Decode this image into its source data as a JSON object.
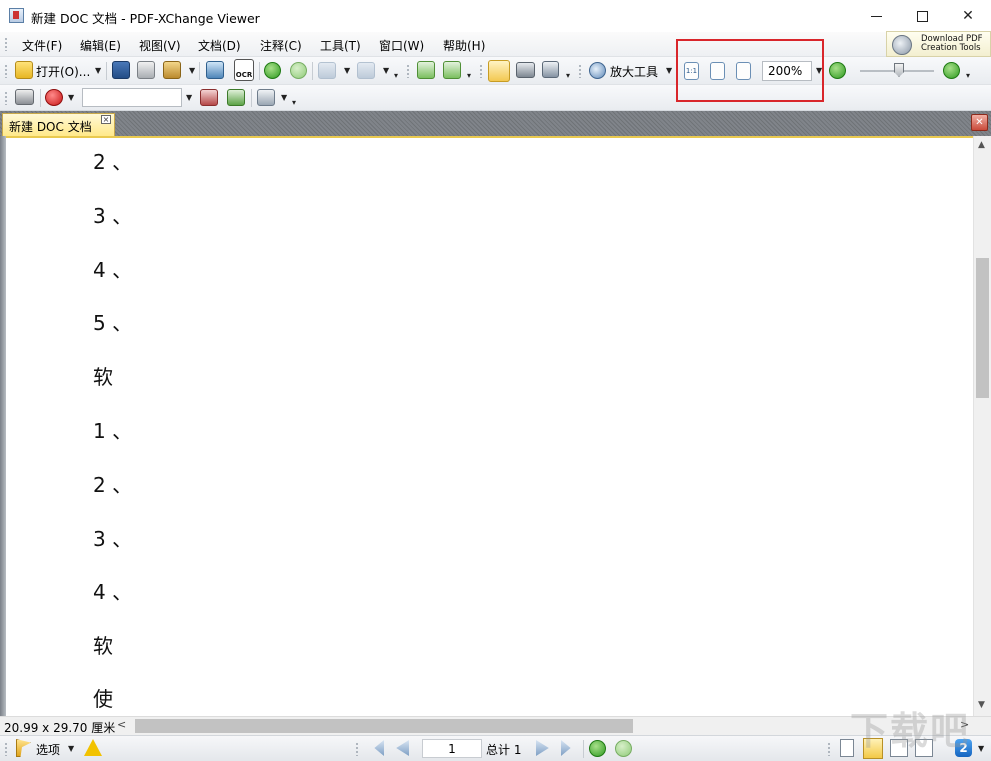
{
  "window": {
    "title": "新建 DOC 文档 - PDF-XChange Viewer"
  },
  "menu": [
    "文件(F)",
    "编辑(E)",
    "视图(V)",
    "文档(D)",
    "注释(C)",
    "工具(T)",
    "窗口(W)",
    "帮助(H)"
  ],
  "download": {
    "line1": "Download PDF",
    "line2": "Creation Tools"
  },
  "toolbar": {
    "open_label": "打开(O)...",
    "ocr_label": "OCR",
    "zoom_tool_label": "放大工具",
    "actual_size_label": "1:1",
    "zoom_value": "200%"
  },
  "tab": {
    "label": "新建 DOC 文档",
    "close": "×"
  },
  "document": {
    "lines": [
      "2 、",
      "3 、",
      "4 、",
      "5 、",
      "软",
      "1 、",
      "2 、",
      "3 、",
      "4 、",
      "软",
      "使"
    ]
  },
  "status": {
    "page_size": "20.99 x 29.70 厘米",
    "options_label": "选项",
    "page_current": "1",
    "page_total": "总计 1"
  },
  "watermark": "下载吧",
  "colors": {
    "highlight": "#d9262b",
    "tab_bg": "#ffe98a"
  }
}
